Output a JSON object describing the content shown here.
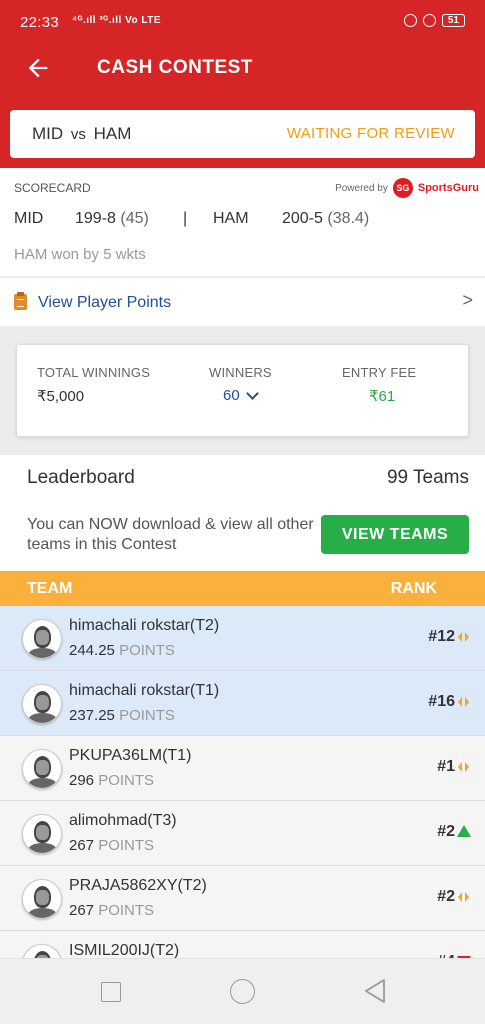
{
  "status_bar": {
    "time": "22:33",
    "network": "⁴ᴳ.ıll ³ᴳ.ıll Vo LTE",
    "battery": "51"
  },
  "header": {
    "title": "CASH CONTEST"
  },
  "match": {
    "team1": "MID",
    "vs": "vs",
    "team2": "HAM",
    "status": "WAITING FOR REVIEW"
  },
  "scorecard": {
    "label": "SCORECARD",
    "powered_by": "Powered by",
    "brand_logo": "SG",
    "brand_name": "SportsGuru",
    "team1": "MID",
    "team1_score": "199-8",
    "team1_overs": "(45)",
    "separator": "|",
    "team2": "HAM",
    "team2_score": "200-5",
    "team2_overs": "(38.4)",
    "result": "HAM won by 5 wkts"
  },
  "player_points": {
    "label": "View Player Points",
    "chevron": ">"
  },
  "summary": {
    "total_winnings_label": "TOTAL WINNINGS",
    "total_winnings": "₹5,000",
    "winners_label": "WINNERS",
    "winners": "60",
    "entry_fee_label": "ENTRY FEE",
    "entry_fee": "₹61"
  },
  "leaderboard": {
    "title": "Leaderboard",
    "teams_count": "99 Teams",
    "message": "You can NOW download & view all other teams in this Contest",
    "button": "VIEW TEAMS"
  },
  "table": {
    "col_team": "TEAM",
    "col_rank": "RANK",
    "points_unit": "POINTS",
    "rows": [
      {
        "name": "himachali rokstar(T2)",
        "points": "244.25",
        "rank": "#12",
        "trend": "same",
        "mine": true
      },
      {
        "name": "himachali rokstar(T1)",
        "points": "237.25",
        "rank": "#16",
        "trend": "same",
        "mine": true
      },
      {
        "name": "PKUPA36LM(T1)",
        "points": "296",
        "rank": "#1",
        "trend": "same",
        "mine": false
      },
      {
        "name": "alimohmad(T3)",
        "points": "267",
        "rank": "#2",
        "trend": "up",
        "mine": false
      },
      {
        "name": "PRAJA5862XY(T2)",
        "points": "267",
        "rank": "#2",
        "trend": "same",
        "mine": false
      },
      {
        "name": "ISMIL200IJ(T2)",
        "points": "",
        "rank": "#4",
        "trend": "down",
        "mine": false
      }
    ]
  },
  "colors": {
    "primary": "#d52526",
    "accent": "#fbb03b",
    "warning": "#f39c12",
    "success": "#27ae46",
    "link": "#1f4e9a"
  }
}
